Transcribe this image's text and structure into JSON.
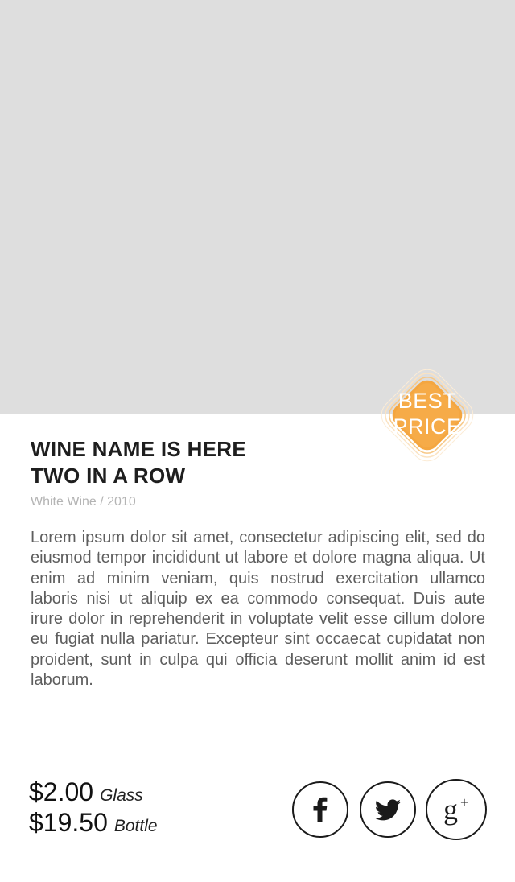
{
  "badge": {
    "line1": "BEST",
    "line2": "PRICE",
    "color": "#f4a640"
  },
  "product": {
    "title_line1": "WINE NAME IS HERE",
    "title_line2": "TWO IN A ROW",
    "subtitle": "White Wine / 2010",
    "description": "Lorem ipsum dolor sit amet, consectetur adipiscing elit, sed do eiusmod tempor incididunt ut labore et dolore magna aliqua. Ut enim ad minim veniam, quis nostrud exercitation ullamco laboris nisi ut aliquip ex ea commodo consequat. Duis aute irure dolor in reprehenderit in voluptate velit esse cillum dolore eu fugiat nulla pariatur. Excepteur sint occaecat cupidatat non proident, sunt in culpa qui officia deserunt mollit anim id est laborum."
  },
  "prices": {
    "glass_price": "$2.00",
    "glass_label": "Glass",
    "bottle_price": "$19.50",
    "bottle_label": "Bottle"
  },
  "social": {
    "facebook_icon": "facebook-icon",
    "twitter_icon": "twitter-icon",
    "googleplus_icon": "google-plus-icon"
  },
  "colors": {
    "hero_placeholder": "#dedede",
    "accent": "#f4a640"
  }
}
